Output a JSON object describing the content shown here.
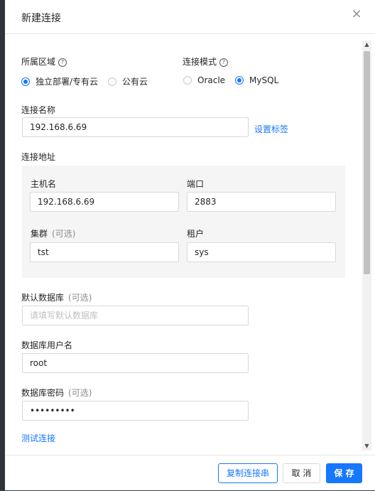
{
  "dialog": {
    "title": "新建连接",
    "close_icon": "close-icon"
  },
  "form": {
    "region": {
      "label": "所属区域",
      "options": [
        {
          "label": "独立部署/专有云",
          "selected": true
        },
        {
          "label": "公有云",
          "selected": false
        }
      ]
    },
    "mode": {
      "label": "连接模式",
      "options": [
        {
          "label": "Oracle",
          "selected": false
        },
        {
          "label": "MySQL",
          "selected": true
        }
      ]
    },
    "name": {
      "label": "连接名称",
      "value": "192.168.6.69",
      "tag_link": "设置标签"
    },
    "address": {
      "label": "连接地址",
      "host": {
        "label": "主机名",
        "value": "192.168.6.69"
      },
      "port": {
        "label": "端口",
        "value": "2883"
      },
      "cluster": {
        "label": "集群",
        "optional": "(可选)",
        "value": "tst"
      },
      "tenant": {
        "label": "租户",
        "value": "sys"
      }
    },
    "default_db": {
      "label": "默认数据库",
      "optional": "(可选)",
      "placeholder": "请填写默认数据库"
    },
    "username": {
      "label": "数据库用户名",
      "value": "root"
    },
    "password": {
      "label": "数据库密码",
      "optional": "(可选)",
      "value": "•••••••••"
    },
    "test_link": "测试连接"
  },
  "footer": {
    "copy_label": "复制连接串",
    "cancel_label": "取 消",
    "save_label": "保 存"
  },
  "colors": {
    "accent": "#1677ff"
  }
}
